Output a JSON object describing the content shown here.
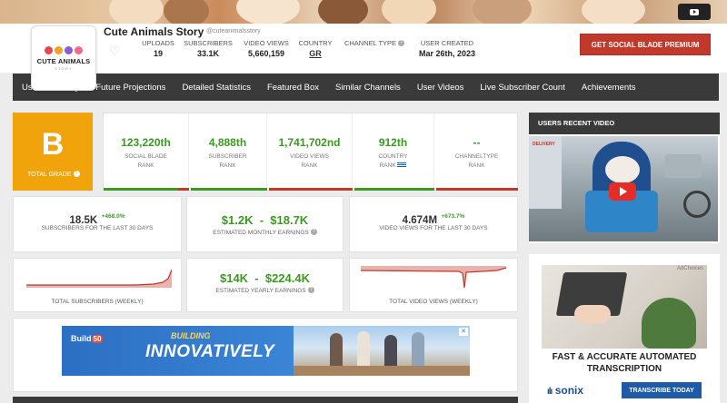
{
  "channel": {
    "logo_text": "CUTE ANIMALS",
    "logo_sub": "STORY",
    "name": "Cute Animals Story",
    "handle": "@cuteanimalsstory"
  },
  "stats": [
    {
      "label": "UPLOADS",
      "value": "19"
    },
    {
      "label": "SUBSCRIBERS",
      "value": "33.1K"
    },
    {
      "label": "VIDEO VIEWS",
      "value": "5,660,159"
    },
    {
      "label": "COUNTRY",
      "value": "GR"
    },
    {
      "label": "CHANNEL TYPE",
      "value": ""
    },
    {
      "label": "USER CREATED",
      "value": "Mar 26th, 2023"
    }
  ],
  "premium_button": "GET SOCIAL BLADE PREMIUM",
  "nav": [
    "User Summary",
    "Future Projections",
    "Detailed Statistics",
    "Featured Box",
    "Similar Channels",
    "User Videos",
    "Live Subscriber Count",
    "Achievements"
  ],
  "grade": {
    "letter": "B",
    "label": "TOTAL GRADE"
  },
  "ranks": [
    {
      "value": "123,220th",
      "line1": "SOCIAL BLADE",
      "line2": "RANK"
    },
    {
      "value": "4,888th",
      "line1": "SUBSCRIBER",
      "line2": "RANK"
    },
    {
      "value": "1,741,702nd",
      "line1": "VIDEO VIEWS",
      "line2": "RANK"
    },
    {
      "value": "912th",
      "line1": "COUNTRY",
      "line2": "RANK"
    },
    {
      "value": "--",
      "line1": "CHANNELTYPE",
      "line2": "RANK"
    }
  ],
  "subs30": {
    "value": "18.5K",
    "delta": "+468.0%",
    "label": "SUBSCRIBERS FOR THE LAST 30 DAYS"
  },
  "monthly": {
    "value": "$1.2K  -  $18.7K",
    "label": "ESTIMATED MONTHLY EARNINGS"
  },
  "views30": {
    "value": "4.674M",
    "delta": "+673.7%",
    "label": "VIDEO VIEWS FOR THE LAST 30 DAYS"
  },
  "weekly_subs_label": "TOTAL SUBSCRIBERS (WEEKLY)",
  "yearly": {
    "value": "$14K  -  $224.4K",
    "label": "ESTIMATED YEARLY EARNINGS"
  },
  "weekly_views_label": "TOTAL VIDEO VIEWS (WEEKLY)",
  "side": {
    "recent_title": "USERS RECENT VIDEO",
    "thumb_sign": "DELIVERY"
  },
  "ad_side": {
    "choices": "AdChoices",
    "headline_1": "FAST & ACCURATE AUTOMATED",
    "headline_2": "TRANSCRIPTION",
    "brand": "sonix",
    "cta": "TRANSCRIBE TODAY"
  },
  "ad_banner": {
    "brand": "Build",
    "brand_badge": "50",
    "tag1": "BUILDING",
    "tag2": "INNOVATIVELY",
    "close": "✕"
  },
  "colors": {
    "accent_green": "#3a9a1e",
    "grade_orange": "#f0a30a",
    "premium_red": "#c0392b",
    "nav_dark": "#3a3a3a"
  }
}
